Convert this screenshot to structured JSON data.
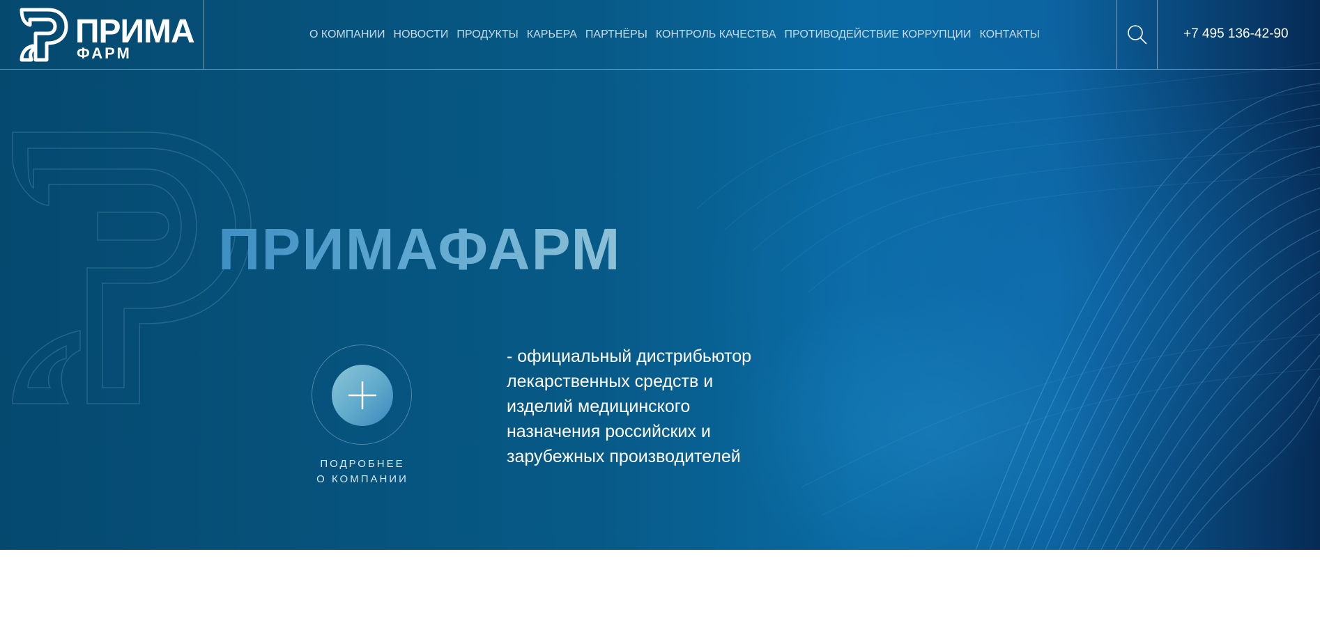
{
  "brand": {
    "name_line1": "ПРИМА",
    "name_line2": "ФАРМ"
  },
  "nav": {
    "items": [
      {
        "label": "О КОМПАНИИ"
      },
      {
        "label": "НОВОСТИ"
      },
      {
        "label": "ПРОДУКТЫ"
      },
      {
        "label": "КАРЬЕРА"
      },
      {
        "label": "ПАРТНЁРЫ"
      },
      {
        "label": "КОНТРОЛЬ КАЧЕСТВА"
      },
      {
        "label": "ПРОТИВОДЕЙСТВИЕ КОРРУПЦИИ"
      },
      {
        "label": "КОНТАКТЫ"
      }
    ]
  },
  "header": {
    "search_icon": "search-icon",
    "phone": "+7 495 136-42-90"
  },
  "hero": {
    "title": "ПРИМАФАРМ",
    "more_icon": "plus-icon",
    "more_label_line1": "ПОДРОБНЕЕ",
    "more_label_line2": "О КОМПАНИИ",
    "description_lines": [
      "- официальный дистрибьютор",
      "лекарственных средств и",
      "изделий медицинского",
      "назначения российских и",
      "зарубежных производителей"
    ]
  },
  "colors": {
    "hero_bg_left": "#05496f",
    "hero_bg_right": "#062b55",
    "title_gradient_start": "#3f8fc3",
    "title_gradient_end": "#8fc1d6",
    "text_white": "#ffffff",
    "nav_text": "#c7dbe8"
  }
}
